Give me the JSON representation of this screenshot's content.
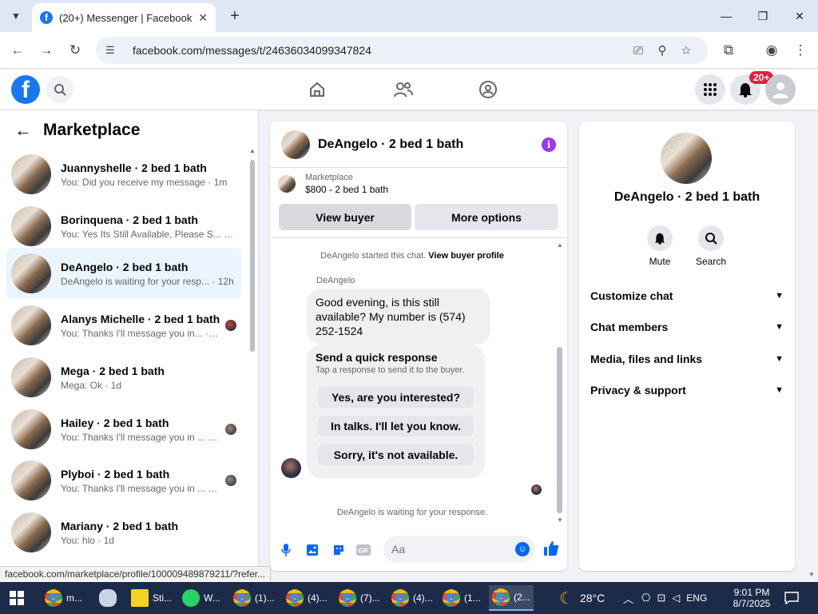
{
  "browser": {
    "tab_title": "(20+) Messenger | Facebook",
    "url": "facebook.com/messages/t/24636034099347824",
    "status_url": "facebook.com/marketplace/profile/100009489879211/?refer..."
  },
  "fb": {
    "notif_badge": "20+"
  },
  "left": {
    "title": "Marketplace",
    "conversations": [
      {
        "name": "Juannyshelle · 2 bed 1 bath",
        "snippet": "You: Did you receive my message · 1m"
      },
      {
        "name": "Borinquena · 2 bed 1 bath",
        "snippet": "You: Yes Its Still Available, Please S... · 1m"
      },
      {
        "name": "DeAngelo · 2 bed 1 bath",
        "snippet": "DeAngelo is waiting for your resp... · 12h"
      },
      {
        "name": "Alanys Michelle · 2 bed 1 bath",
        "snippet": "You: Thanks I'll message you in... · 23h"
      },
      {
        "name": "Mega · 2 bed 1 bath",
        "snippet": "Mega: Ok · 1d"
      },
      {
        "name": "Hailey · 2 bed 1 bath",
        "snippet": "You: Thanks I'll message you in ... · 1d"
      },
      {
        "name": "Plyboi · 2 bed 1 bath",
        "snippet": "You: Thanks I'll message you in ... · 1d"
      },
      {
        "name": "Mariany · 2 bed 1 bath",
        "snippet": "You: hlo · 1d"
      }
    ]
  },
  "chat": {
    "title": "DeAngelo · 2 bed 1 bath",
    "listing_source": "Marketplace",
    "listing_desc": "$800 - 2 bed 1 bath",
    "view_buyer": "View buyer",
    "more_options": "More options",
    "started_text": "DeAngelo started this chat.",
    "view_profile": "View buyer profile",
    "sender": "DeAngelo",
    "message": "Good evening, is this still available? My number is (574) 252-1524",
    "quick_title": "Send a quick response",
    "quick_sub": "Tap a response to send it to the buyer.",
    "quick_replies": [
      "Yes, are you interested?",
      "In talks. I'll let you know.",
      "Sorry, it's not available."
    ],
    "waiting": "DeAngelo is waiting for your response.",
    "input_placeholder": "Aa"
  },
  "right": {
    "name": "DeAngelo · 2 bed 1 bath",
    "mute": "Mute",
    "search": "Search",
    "sections": [
      "Customize chat",
      "Chat members",
      "Media, files and links",
      "Privacy & support"
    ]
  },
  "taskbar": {
    "items": [
      "m...",
      "",
      "Sti...",
      "W...",
      "(1)...",
      "(4)...",
      "(7)...",
      "(4)...",
      "(1...",
      "(2..."
    ],
    "weather": "28°C",
    "lang": "ENG",
    "time": "9:01 PM",
    "date": "8/7/2025"
  },
  "colors": {
    "fb_blue": "#1877f2",
    "messenger_blue": "#0866ff",
    "active_row": "#ebf5ff",
    "badge_red": "#e41e3f"
  }
}
